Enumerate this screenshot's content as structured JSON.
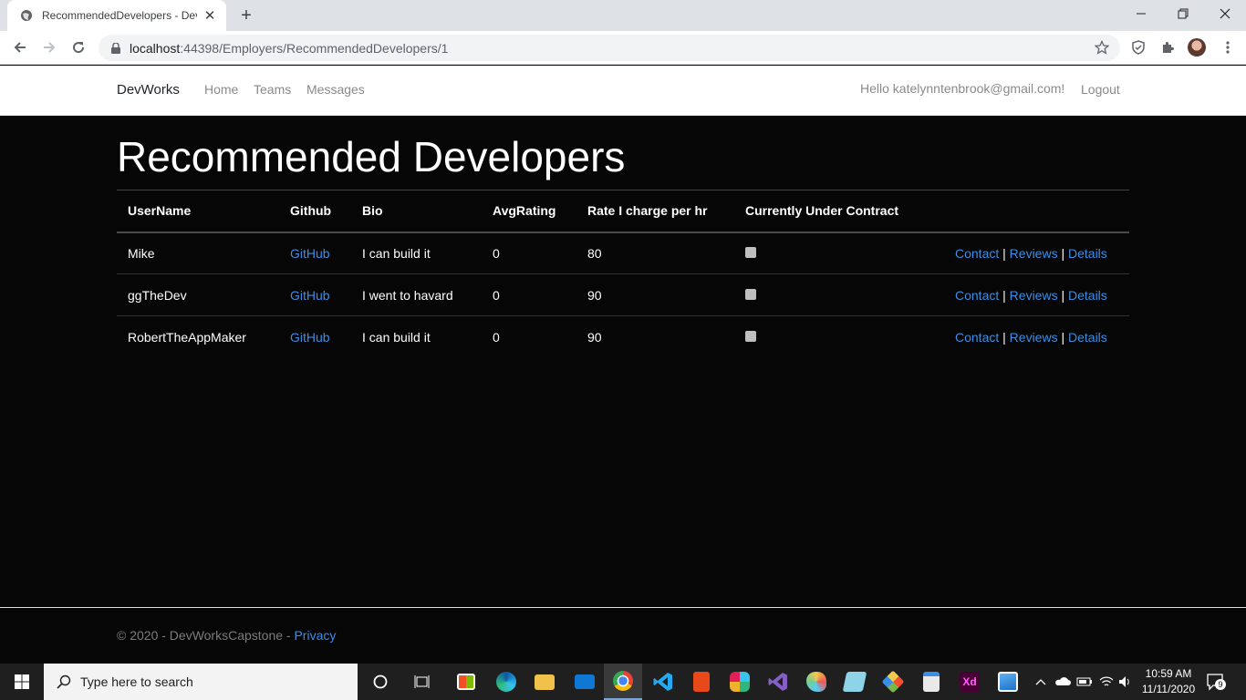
{
  "browser": {
    "tab_title": "RecommendedDevelopers - DevWorks",
    "url_host": "localhost",
    "url_path": ":44398/Employers/RecommendedDevelopers/1"
  },
  "nav": {
    "brand": "DevWorks",
    "links": [
      "Home",
      "Teams",
      "Messages"
    ],
    "greeting": "Hello katelynntenbrook@gmail.com!",
    "logout": "Logout"
  },
  "page": {
    "title": "Recommended Developers",
    "columns": [
      "UserName",
      "Github",
      "Bio",
      "AvgRating",
      "Rate I charge per hr",
      "Currently Under Contract"
    ],
    "rows": [
      {
        "username": "Mike",
        "github": "GitHub",
        "bio": "I can build it",
        "avg_rating": "0",
        "rate": "80",
        "under_contract": false
      },
      {
        "username": "ggTheDev",
        "github": "GitHub",
        "bio": "I went to havard",
        "avg_rating": "0",
        "rate": "90",
        "under_contract": false
      },
      {
        "username": "RobertTheAppMaker",
        "github": "GitHub",
        "bio": "I can build it",
        "avg_rating": "0",
        "rate": "90",
        "under_contract": false
      }
    ],
    "actions": {
      "contact": "Contact",
      "reviews": "Reviews",
      "details": "Details",
      "separator": "|"
    }
  },
  "footer": {
    "text": "© 2020 - DevWorksCapstone - ",
    "privacy": "Privacy"
  },
  "taskbar": {
    "search_placeholder": "Type here to search",
    "time": "10:59 AM",
    "date": "11/11/2020",
    "notifications": "9"
  },
  "colors": {
    "link": "#3a8ee6",
    "page_bg": "#060606",
    "nav_text": "#8a8a8a"
  }
}
